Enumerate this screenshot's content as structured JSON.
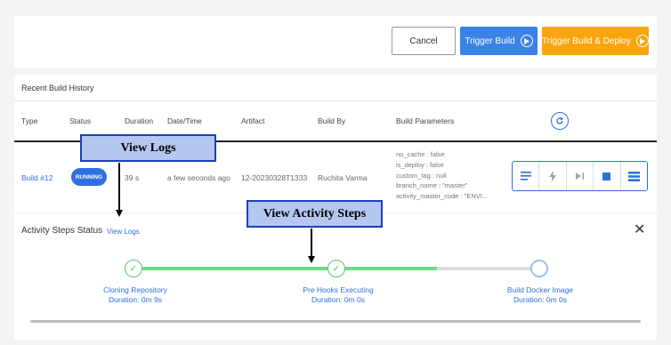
{
  "toolbar": {
    "cancel_label": "Cancel",
    "trigger_build_label": "Trigger Build",
    "trigger_build_deploy_label": "Trigger Build & Deploy"
  },
  "history": {
    "title": "Recent Build History",
    "columns": [
      "Type",
      "Status",
      "Duration",
      "Date/Time",
      "Artifact",
      "Build By",
      "Build Parameters"
    ],
    "row": {
      "type": "Build #12",
      "status": "RUNNING",
      "duration": "39 s",
      "datetime": "a few seconds ago",
      "artifact": "12-20230328T1333",
      "build_by": "Ruchita Varma",
      "params": [
        "no_cache : false",
        "is_deploy : false",
        "custom_tag : null",
        "branch_name : \"master\"",
        "activity_master_code : \"ENVI..."
      ]
    },
    "action_icons": [
      "logs-icon",
      "activity-steps-icon",
      "skip-icon",
      "stop-icon",
      "list-icon"
    ]
  },
  "activity": {
    "title": "Activity Steps Status",
    "view_logs": "View Logs",
    "steps": [
      {
        "name": "Cloning Repository",
        "duration": "Duration: 0m 9s",
        "state": "done"
      },
      {
        "name": "Pre Hooks Executing",
        "duration": "Duration: 0m 0s",
        "state": "done"
      },
      {
        "name": "Build Docker Image",
        "duration": "Duration: 0m 0s",
        "state": "in-progress"
      }
    ]
  },
  "annotations": {
    "view_logs": "View Logs",
    "view_activity_steps": "View Activity Steps"
  },
  "colors": {
    "primary": "#3b82e6",
    "deploy": "#f9a50e",
    "success": "#6fdb7f",
    "link": "#2e6fd9"
  }
}
